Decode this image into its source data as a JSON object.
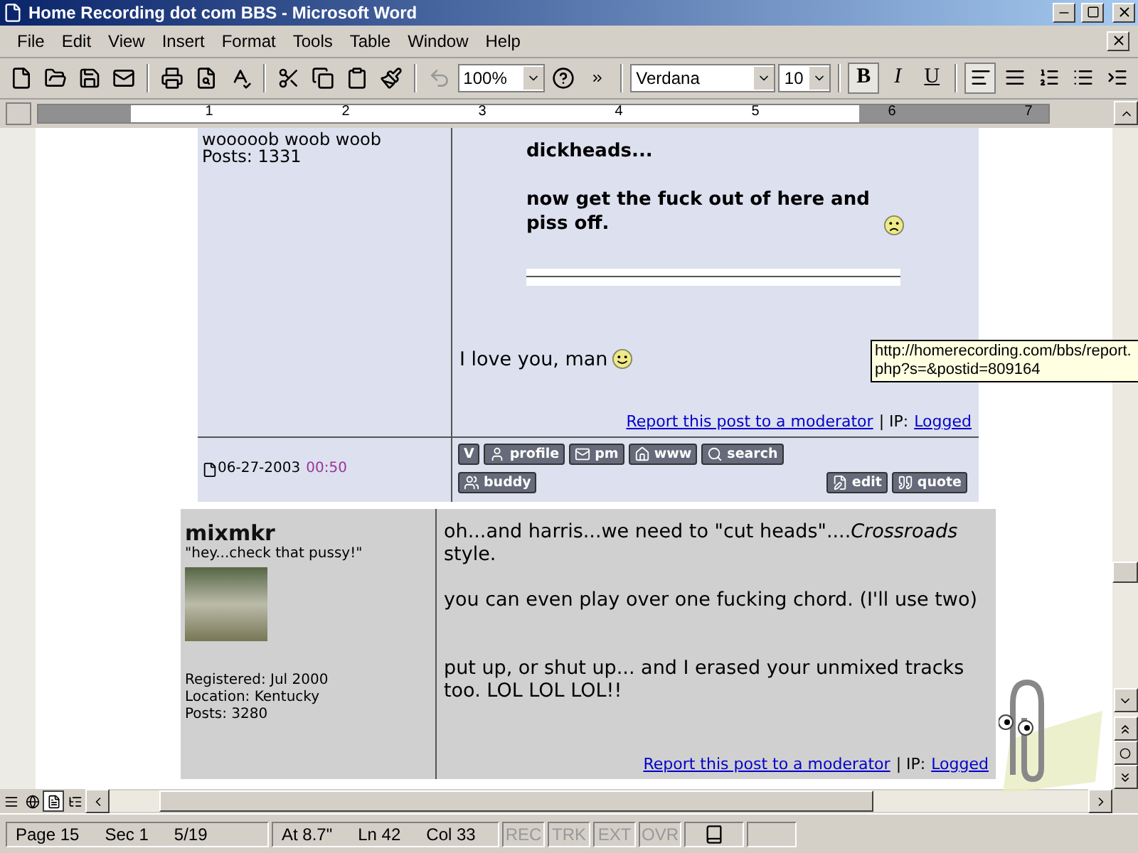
{
  "window": {
    "title": "Home Recording dot com BBS - Microsoft Word"
  },
  "menu": [
    "File",
    "Edit",
    "View",
    "Insert",
    "Format",
    "Tools",
    "Table",
    "Window",
    "Help"
  ],
  "toolbar": {
    "zoom": "100%",
    "font": "Verdana",
    "size": "10"
  },
  "format_buttons": [
    {
      "label": "B",
      "kind": "bold",
      "selected": true
    },
    {
      "label": "I",
      "kind": "italic",
      "selected": false
    },
    {
      "label": "U",
      "kind": "underline",
      "selected": false
    }
  ],
  "paragraph_buttons": [
    {
      "kind": "align-left",
      "selected": true
    },
    {
      "kind": "justify",
      "selected": false
    },
    {
      "kind": "numbering",
      "selected": false
    },
    {
      "kind": "bullets",
      "selected": false
    },
    {
      "kind": "indent",
      "selected": false
    }
  ],
  "ruler": [
    "1",
    "2",
    "3",
    "4",
    "5",
    "6",
    "7"
  ],
  "posts": [
    {
      "kind": "lavender",
      "sidebar": [
        "wooooob woob woob",
        "Posts: 1331"
      ],
      "body": [
        {
          "kind": "bold",
          "text": "dickheads..."
        },
        {
          "kind": "bold-smiley",
          "text": "now get the fuck out of here and piss off."
        },
        {
          "kind": "divider"
        },
        {
          "kind": "smiley",
          "text": "I love you, man"
        }
      ],
      "report": "Report this post to a moderator",
      "ip": "| IP:",
      "logged": "Logged",
      "date": "06-27-2003",
      "time": "00:50",
      "buttons": [
        {
          "kind": "letter",
          "label": "V"
        },
        {
          "kind": "profile",
          "label": "profile"
        },
        {
          "kind": "pm",
          "label": "pm"
        },
        {
          "kind": "www",
          "label": "www"
        },
        {
          "kind": "search",
          "label": "search"
        },
        {
          "kind": "buddy",
          "label": "buddy"
        }
      ],
      "actions": [
        {
          "kind": "edit",
          "label": "edit"
        },
        {
          "kind": "quote",
          "label": "quote"
        }
      ]
    },
    {
      "kind": "grey",
      "username": "mixmkr",
      "user_title": "\"hey...check that pussy!\"",
      "sidebar": [
        "Registered: Jul 2000",
        "Location: Kentucky",
        "Posts: 3280"
      ],
      "body": [
        {
          "kind": "plain",
          "text": "oh...and harris...we need to \"cut heads\"....*Crossroads* style."
        },
        {
          "kind": "plain",
          "text": "you can even play over one fucking chord. (I'll use two)"
        },
        {
          "kind": "gap"
        },
        {
          "kind": "plain",
          "text": "put up, or shut up... and I erased your unmixed tracks too. LOL LOL LOL!!"
        }
      ],
      "report": "Report this post to a moderator",
      "ip": "| IP:",
      "logged": "Logged"
    }
  ],
  "tooltip": [
    "http://homerecording.com/bbs/report.",
    "php?s=&postid=809164"
  ],
  "view_buttons": [
    {
      "kind": "normal",
      "selected": false
    },
    {
      "kind": "web",
      "selected": false
    },
    {
      "kind": "print",
      "selected": true
    },
    {
      "kind": "outline",
      "selected": false
    }
  ],
  "status_bar": {
    "groups": [
      [
        "Page 15",
        "Sec 1",
        "5/19"
      ],
      [
        "At 8.7\"",
        "Ln 42",
        "Col 33"
      ]
    ],
    "modes": [
      {
        "label": "REC",
        "on": false
      },
      {
        "label": "TRK",
        "on": false
      },
      {
        "label": "EXT",
        "on": false
      },
      {
        "label": "OVR",
        "on": false
      }
    ]
  }
}
